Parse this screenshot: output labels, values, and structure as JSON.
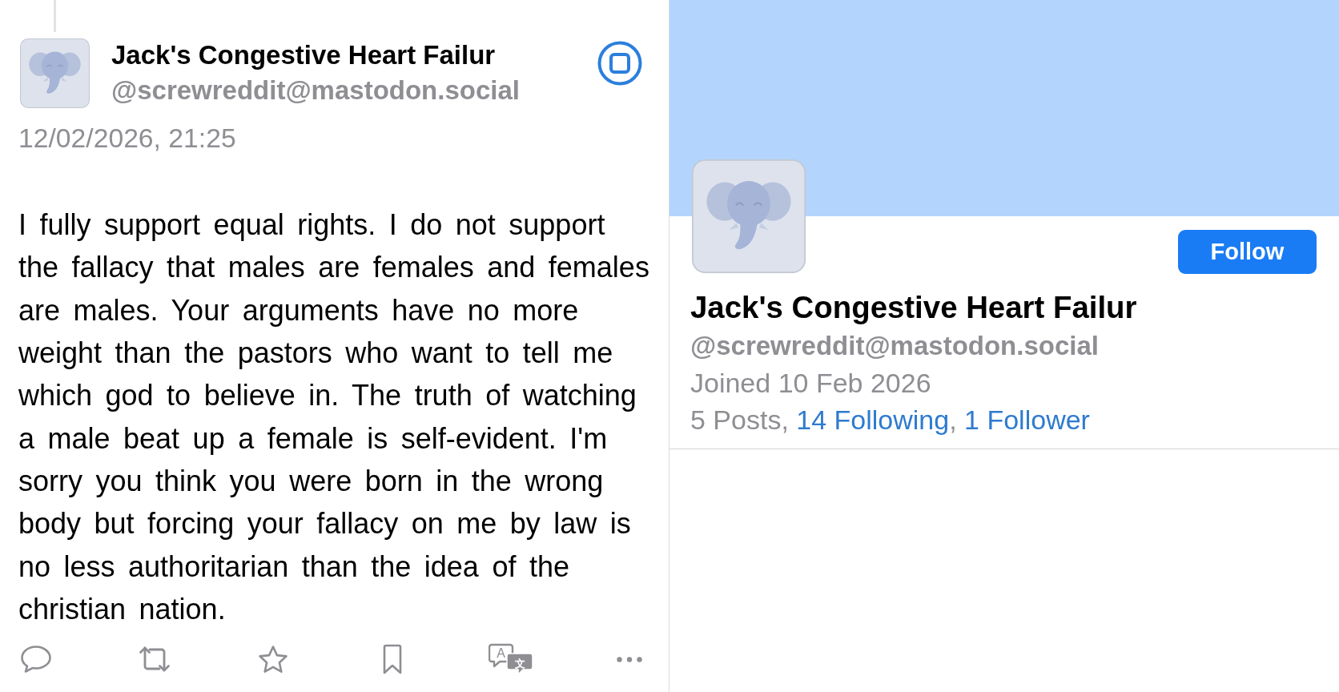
{
  "post": {
    "author": {
      "name": "Jack's Congestive Heart Failur",
      "handle": "@screwreddit@mastodon.social"
    },
    "timestamp": "12/02/2026, 21:25",
    "body": "I fully support equal rights. I do not support the fallacy that males are females and females are males. Your arguments have no more weight than the pastors who want to tell me which god to believe in. The truth of watching a male beat up a female is self-evident. I'm sorry you think you were born in the wrong body but forcing your fallacy on me by law is no less authoritarian than the idea of the christian nation.",
    "translate_icon_letters": [
      "A",
      "文"
    ]
  },
  "profile": {
    "follow_button": "Follow",
    "name": "Jack's Congestive Heart Failur",
    "handle": "@screwreddit@mastodon.social",
    "joined": "Joined 10 Feb 2026",
    "stats": [
      {
        "kind": "text",
        "text": "5 Posts, "
      },
      {
        "kind": "link",
        "text": "14 Following"
      },
      {
        "kind": "text",
        "text": ", "
      },
      {
        "kind": "link",
        "text": "1 Follower"
      }
    ]
  }
}
